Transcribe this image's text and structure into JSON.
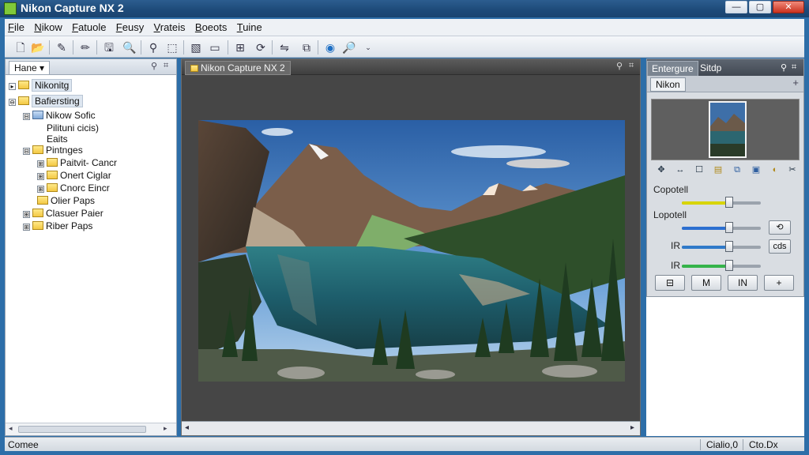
{
  "window": {
    "title": "Nikon Capture NX 2",
    "controls": {
      "minimize": "—",
      "maximize": "▢",
      "close": "✕"
    }
  },
  "menu": [
    "File",
    "Nikow",
    "Fatuole",
    "Feusy",
    "Vrateis",
    "Boeots",
    "Tuine"
  ],
  "toolbar": {
    "icons": [
      "new-icon",
      "open-folder-icon",
      "pipette-icon",
      "pencil-icon",
      "save-icon",
      "zoom-icon",
      "search-icon",
      "crop-icon",
      "image-icon",
      "screen-icon",
      "grid-icon",
      "rotate-icon",
      "compare-icon",
      "globe-icon",
      "magnify-icon",
      "dropdown-icon"
    ]
  },
  "left_panel": {
    "tab": "Hane",
    "tree": [
      {
        "label": "Nikonitg",
        "indent": 0,
        "highlight": true,
        "blue": false,
        "expander": "▸"
      },
      {
        "label": "Bafiersting",
        "indent": 0,
        "highlight": true,
        "blue": false,
        "expander": "⊖"
      },
      {
        "label": "Nikow Sofic",
        "indent": 1,
        "highlight": false,
        "blue": true,
        "expander": "⊟"
      },
      {
        "label": "Pilituni cicis)",
        "indent": 2,
        "highlight": false,
        "blue": false,
        "expander": "",
        "bare": true
      },
      {
        "label": "Eaits",
        "indent": 2,
        "highlight": false,
        "blue": false,
        "expander": "",
        "bare": true
      },
      {
        "label": "Pintnges",
        "indent": 1,
        "highlight": false,
        "blue": false,
        "expander": "⊟"
      },
      {
        "label": "Paitvit- Cancr",
        "indent": 2,
        "highlight": false,
        "blue": false,
        "expander": "⊞"
      },
      {
        "label": "Onert Ciglar",
        "indent": 2,
        "highlight": false,
        "blue": false,
        "expander": "⊞"
      },
      {
        "label": "Cnorc Eincr",
        "indent": 2,
        "highlight": false,
        "blue": false,
        "expander": "⊞"
      },
      {
        "label": "Olier Paps",
        "indent": 2,
        "highlight": false,
        "blue": false,
        "expander": ""
      },
      {
        "label": "Clasuer Paier",
        "indent": 1,
        "highlight": false,
        "blue": false,
        "expander": "⊞"
      },
      {
        "label": "Riber Paps",
        "indent": 1,
        "highlight": false,
        "blue": false,
        "expander": "⊞"
      }
    ]
  },
  "center_panel": {
    "tab": "Nikon Capture NX 2"
  },
  "right_panel": {
    "tabs": [
      "Entergure",
      "Sitdp"
    ],
    "subtab": "Nikon",
    "icons": [
      "edit-icon",
      "arrows-icon",
      "frame-icon",
      "document-icon",
      "layers-icon",
      "image-adjust-icon",
      "levels-icon",
      "tools-icon"
    ],
    "sliders": [
      {
        "label": "Copotell",
        "color": "#d8d400",
        "value": 0.6
      },
      {
        "label": "Lopotell",
        "color": "#2c6fd0",
        "value": 0.6,
        "button": "⟲"
      },
      {
        "label": "IR",
        "color": "#2f79c9",
        "value": 0.6,
        "button": "cds"
      },
      {
        "label": "IR",
        "color": "#35b34a",
        "value": 0.6
      }
    ],
    "bottom_buttons": [
      "⊟",
      "M",
      "IN",
      "+"
    ]
  },
  "status": {
    "left": "Comee",
    "right1": "Cialio,0",
    "right2": "Cto.Dx"
  }
}
